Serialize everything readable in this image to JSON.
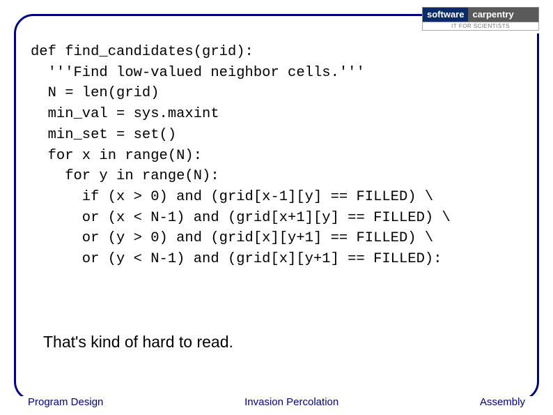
{
  "logo": {
    "left": "software",
    "right": "carpentry",
    "tagline": "IT FOR SCIENTISTS"
  },
  "code": {
    "l1": "def find_candidates(grid):",
    "l2": "  '''Find low-valued neighbor cells.'''",
    "l3": "  N = len(grid)",
    "l4": "  min_val = sys.maxint",
    "l5": "  min_set = set()",
    "l6": "  for x in range(N):",
    "l7": "    for y in range(N):",
    "l8": "      if (x > 0) and (grid[x-1][y] == FILLED) \\",
    "l9": "      or (x < N-1) and (grid[x+1][y] == FILLED) \\",
    "l10": "      or (y > 0) and (grid[x][y+1] == FILLED) \\",
    "l11": "      or (y < N-1) and (grid[x][y+1] == FILLED):"
  },
  "comment": "That's kind of hard to read.",
  "footer": {
    "left": "Program Design",
    "center": "Invasion Percolation",
    "right": "Assembly"
  }
}
